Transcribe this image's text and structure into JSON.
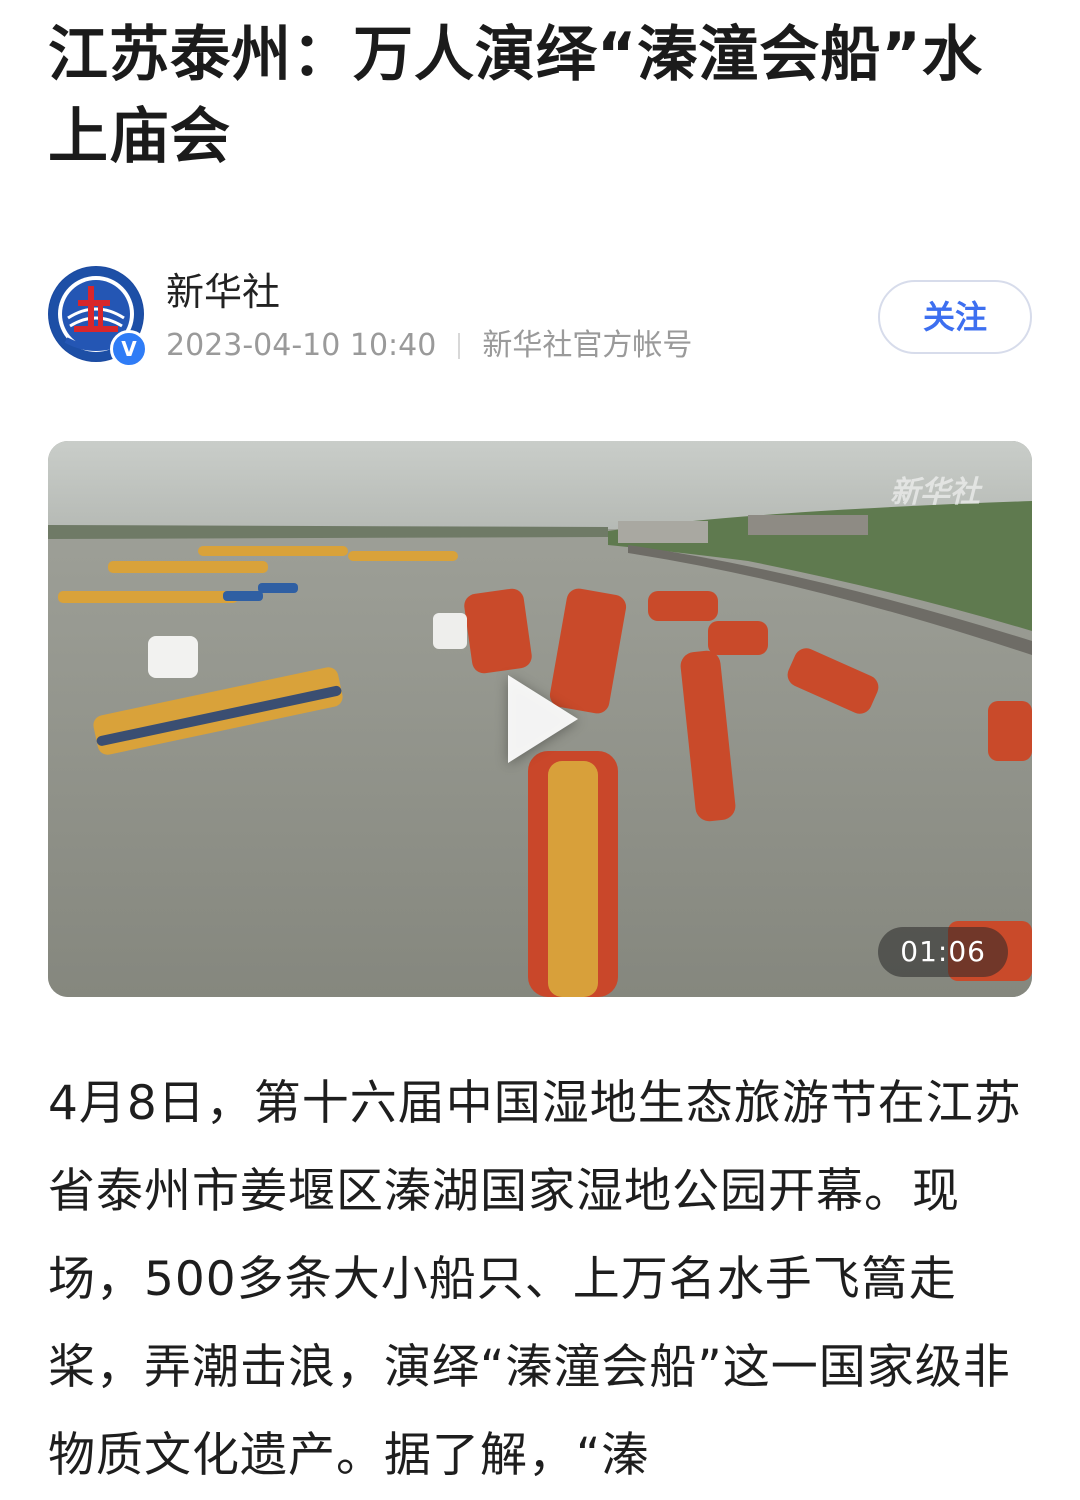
{
  "article": {
    "title": "江苏泰州：万人演绎“溱潼会船”水上庙会",
    "author": {
      "name": "新华社",
      "datetime": "2023-04-10 10:40",
      "account_type": "新华社官方帐号",
      "verified_icon": "verified-v-icon",
      "follow_label": "关注"
    },
    "video": {
      "duration": "01:06",
      "watermark": "新华社"
    },
    "body": "4月8日，第十六届中国湿地生态旅游节在江苏省泰州市姜堰区溱湖国家湿地公园开幕。现场，500多条大小船只、上万名水手飞篙走桨，弄潮击浪，演绎“溱潼会船”这一国家级非物质文化遗产。据了解，“溱"
  },
  "colors": {
    "accent": "#3d6ff0",
    "meta_gray": "#9a9a9a",
    "water": "#8f9189",
    "verified_blue": "#2f7cf6"
  }
}
